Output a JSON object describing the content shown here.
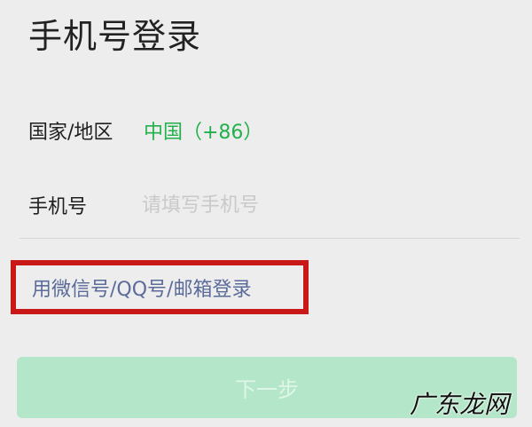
{
  "page": {
    "title": "手机号登录"
  },
  "form": {
    "country_label": "国家/地区",
    "country_value": "中国（+86）",
    "phone_label": "手机号",
    "phone_placeholder": "请填写手机号",
    "phone_value": ""
  },
  "actions": {
    "alt_login_label": "用微信号/QQ号/邮箱登录",
    "next_label": "下一步"
  },
  "watermark": {
    "text": "广东龙网"
  },
  "colors": {
    "accent_green": "#22b14c",
    "link_blue": "#5b6b9a",
    "highlight_red": "#c81818",
    "button_disabled_green": "#b4e7c9"
  }
}
